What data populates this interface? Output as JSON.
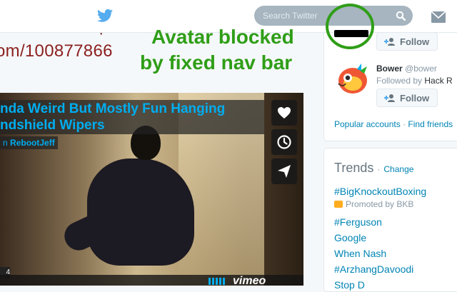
{
  "nav": {
    "search_placeholder": "Search Twitter"
  },
  "page": {
    "heading_fragment": "Windshield Wiper",
    "url_fragment": "om/100877866"
  },
  "video": {
    "title_line1": "nda Weird But Mostly Fun Hanging",
    "title_line2": "ndshield Wipers",
    "byline_prefix": "n",
    "byline_author": "RebootJeff",
    "time_fragment": "4",
    "brand": "vimeo",
    "title_color": "#00adef"
  },
  "who_to_follow": {
    "follow_label": "Follow",
    "user": {
      "name": "Bower",
      "handle": "@bower",
      "followed_by_prefix": "Followed by",
      "followed_by_name": "Hack R"
    },
    "footer_popular": "Popular accounts",
    "footer_separator": "·",
    "footer_find": "Find friends"
  },
  "trends": {
    "title": "Trends",
    "separator": "·",
    "change_label": "Change",
    "items": [
      {
        "label": "#BigKnockoutBoxing"
      },
      {
        "label": "#Ferguson"
      },
      {
        "label": "Google"
      },
      {
        "label": "When Nash"
      },
      {
        "label": "#ArzhangDavoodi"
      },
      {
        "label": "Stop D"
      }
    ],
    "promoted": "Promoted by BKB"
  },
  "annotation": {
    "line1": "Avatar blocked",
    "line2": "by fixed nav bar",
    "color": "#2f9e17"
  },
  "colors": {
    "twitter_blue": "#55acee",
    "link_blue": "#0084b4"
  }
}
